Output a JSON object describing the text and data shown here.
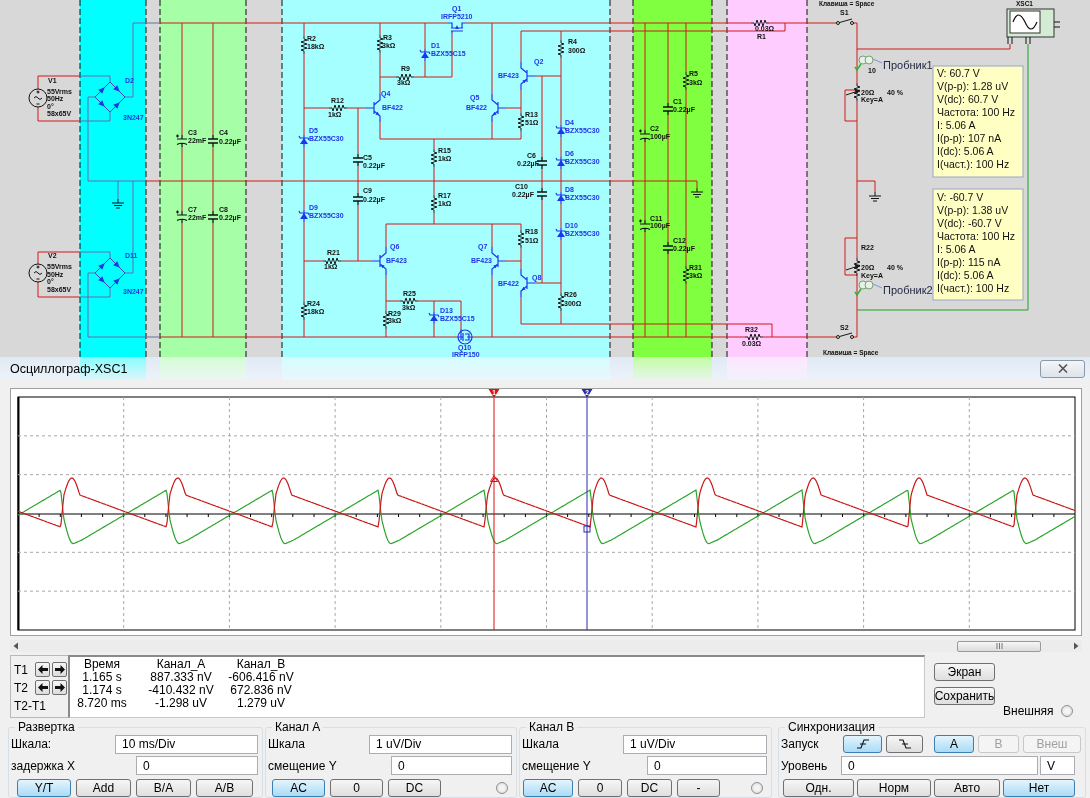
{
  "schematic": {
    "zones": [
      {
        "color": "#00ffff"
      },
      {
        "color": "#a6ffa6"
      },
      {
        "color": "#a6ffff"
      },
      {
        "color": "#80ff40"
      },
      {
        "color": "#ffccff"
      }
    ],
    "components": [
      {
        "kind": "ac-source",
        "ref": "V1",
        "values": [
          "55Vrms",
          "50Hz",
          "0°",
          "58x65V"
        ]
      },
      {
        "kind": "bridge",
        "ref": "D2",
        "values": [
          "3N247"
        ]
      },
      {
        "kind": "ac-source",
        "ref": "V2",
        "values": [
          "55Vrms",
          "50Hz",
          "0°",
          "58x65V"
        ]
      },
      {
        "kind": "bridge",
        "ref": "D11",
        "values": [
          "3N247"
        ]
      },
      {
        "kind": "polar-capacitor",
        "ref": "C3",
        "values": [
          "22mF"
        ]
      },
      {
        "kind": "capacitor",
        "ref": "C4",
        "values": [
          "0.22µF"
        ]
      },
      {
        "kind": "polar-capacitor",
        "ref": "C7",
        "values": [
          "22mF"
        ]
      },
      {
        "kind": "capacitor",
        "ref": "C8",
        "values": [
          "0.22µF"
        ]
      },
      {
        "kind": "resistor",
        "ref": "R2",
        "values": [
          "18kΩ"
        ]
      },
      {
        "kind": "resistor",
        "ref": "R12",
        "values": [
          "1kΩ"
        ]
      },
      {
        "kind": "zener",
        "ref": "D5",
        "values": [
          "BZX55C30"
        ]
      },
      {
        "kind": "zener",
        "ref": "D9",
        "values": [
          "BZX55C30"
        ]
      },
      {
        "kind": "resistor",
        "ref": "R21",
        "values": [
          "1kΩ"
        ]
      },
      {
        "kind": "resistor",
        "ref": "R24",
        "values": [
          "18kΩ"
        ]
      },
      {
        "kind": "mosfet",
        "ref": "Q1",
        "values": [
          "IRFP5210"
        ]
      },
      {
        "kind": "resistor",
        "ref": "R3",
        "values": [
          "3kΩ"
        ]
      },
      {
        "kind": "zener",
        "ref": "D1",
        "values": [
          "BZX55C15"
        ]
      },
      {
        "kind": "resistor",
        "ref": "R9",
        "values": [
          "3kΩ"
        ]
      },
      {
        "kind": "npn",
        "ref": "Q4",
        "values": [
          "BF422"
        ]
      },
      {
        "kind": "npn",
        "ref": "Q5",
        "values": [
          "BF422"
        ]
      },
      {
        "kind": "capacitor",
        "ref": "C5",
        "values": [
          "0.22µF"
        ]
      },
      {
        "kind": "resistor",
        "ref": "R15",
        "values": [
          "1kΩ"
        ]
      },
      {
        "kind": "capacitor",
        "ref": "C9",
        "values": [
          "0.22µF"
        ]
      },
      {
        "kind": "resistor",
        "ref": "R17",
        "values": [
          "1kΩ"
        ]
      },
      {
        "kind": "pnp",
        "ref": "Q6",
        "values": [
          "BF423"
        ]
      },
      {
        "kind": "resistor",
        "ref": "R25",
        "values": [
          "3kΩ"
        ]
      },
      {
        "kind": "resistor",
        "ref": "R29",
        "values": [
          "3kΩ"
        ]
      },
      {
        "kind": "zener",
        "ref": "D13",
        "values": [
          "BZX55C15"
        ]
      },
      {
        "kind": "mosfet",
        "ref": "Q10",
        "values": [
          "IRFP150"
        ]
      },
      {
        "kind": "pnp",
        "ref": "Q2",
        "values": [
          "BF423"
        ]
      },
      {
        "kind": "resistor",
        "ref": "R4",
        "values": [
          "300Ω"
        ]
      },
      {
        "kind": "resistor",
        "ref": "R13",
        "values": [
          "51Ω"
        ]
      },
      {
        "kind": "zener",
        "ref": "D4",
        "values": [
          "BZX55C30"
        ]
      },
      {
        "kind": "capacitor",
        "ref": "C6",
        "values": [
          "0.22µF"
        ]
      },
      {
        "kind": "zener",
        "ref": "D6",
        "values": [
          "BZX55C30"
        ]
      },
      {
        "kind": "capacitor",
        "ref": "C10",
        "values": [
          "0.22µF"
        ]
      },
      {
        "kind": "zener",
        "ref": "D8",
        "values": [
          "BZX55C30"
        ]
      },
      {
        "kind": "zener",
        "ref": "D10",
        "values": [
          "BZX55C30"
        ]
      },
      {
        "kind": "resistor",
        "ref": "R18",
        "values": [
          "51Ω"
        ]
      },
      {
        "kind": "pnp",
        "ref": "Q7",
        "values": [
          "BF423"
        ]
      },
      {
        "kind": "npn",
        "ref": "Q8",
        "values": [
          "BF422"
        ]
      },
      {
        "kind": "resistor",
        "ref": "R26",
        "values": [
          "300Ω"
        ]
      },
      {
        "kind": "resistor",
        "ref": "R5",
        "values": [
          "3kΩ"
        ]
      },
      {
        "kind": "capacitor",
        "ref": "C1",
        "values": [
          "0.22µF"
        ]
      },
      {
        "kind": "polar-capacitor",
        "ref": "C2",
        "values": [
          "100µF"
        ]
      },
      {
        "kind": "polar-capacitor",
        "ref": "C11",
        "values": [
          "100µF"
        ]
      },
      {
        "kind": "capacitor",
        "ref": "C12",
        "values": [
          "0.22µF"
        ]
      },
      {
        "kind": "resistor",
        "ref": "R31",
        "values": [
          "3kΩ"
        ]
      },
      {
        "kind": "resistor",
        "ref": "R1",
        "values": [
          "0.03Ω"
        ]
      },
      {
        "kind": "resistor",
        "ref": "R32",
        "values": [
          "0.03Ω"
        ]
      },
      {
        "kind": "switch",
        "ref": "S1",
        "values": [
          "Клавиша = Space"
        ]
      },
      {
        "kind": "switch",
        "ref": "S2",
        "values": [
          "Клавиша = Space"
        ]
      },
      {
        "kind": "potentiometer",
        "ref": "10",
        "values": [
          "20Ω",
          "Key=A",
          "40 %"
        ]
      },
      {
        "kind": "potentiometer",
        "ref": "R22",
        "values": [
          "20Ω",
          "Key=A",
          "40 %"
        ]
      }
    ],
    "probes": [
      {
        "label": "Пробник1",
        "readings": [
          "V: 60.7 V",
          "V(p-p): 1.28 uV",
          "V(dc): 60.7 V",
          "Частота: 100 Hz",
          "I: 5.06 A",
          "I(p-p): 107 nA",
          "I(dc): 5.06 A",
          "I(част.): 100 Hz"
        ]
      },
      {
        "label": "Пробник2",
        "readings": [
          "V: -60.7 V",
          "V(p-p): 1.38 uV",
          "V(dc): -60.7 V",
          "Частота: 100 Hz",
          "I: 5.06 A",
          "I(p-p): 115 nA",
          "I(dc): 5.06 A",
          "I(част.): 100 Hz"
        ]
      }
    ],
    "instrument": {
      "ref": "XSC1"
    }
  },
  "oscilloscope": {
    "title": "Осциллограф-XSC1",
    "cursors": [
      {
        "label": "1",
        "color": "#e01010"
      },
      {
        "label": "2",
        "color": "#2a2ab0"
      }
    ],
    "readout": {
      "cursor_labels": [
        "T1",
        "T2",
        "T2-T1"
      ],
      "columns": [
        "Время",
        "Канал_A",
        "Канал_B"
      ],
      "rows": [
        [
          "1.165 s",
          "887.333 nV",
          "-606.416 nV"
        ],
        [
          "1.174 s",
          "-410.432 nV",
          "672.836 nV"
        ],
        [
          "8.720 ms",
          "-1.298 uV",
          "1.279 uV"
        ]
      ]
    },
    "actions": [
      "Экран",
      "Сохранить"
    ],
    "external": {
      "label": "Внешняя",
      "checked": false
    },
    "timebase": {
      "title": "Развертка",
      "fields": [
        {
          "label": "Шкала:",
          "value": "10 ms/Div"
        },
        {
          "label": "задержка X",
          "value": "0"
        }
      ],
      "modes": [
        {
          "label": "Y/T",
          "selected": true
        },
        {
          "label": "Add",
          "selected": false
        },
        {
          "label": "B/A",
          "selected": false
        },
        {
          "label": "A/B",
          "selected": false
        }
      ]
    },
    "channels": [
      {
        "title": "Канал A",
        "fields": [
          {
            "label": "Шкала",
            "value": "1 uV/Div"
          },
          {
            "label": "смещение Y",
            "value": "0"
          }
        ],
        "coupling": [
          {
            "label": "AC",
            "selected": true
          },
          {
            "label": "0",
            "selected": false
          },
          {
            "label": "DC",
            "selected": false
          }
        ],
        "radio": {
          "checked": false
        }
      },
      {
        "title": "Канал B",
        "fields": [
          {
            "label": "Шкала",
            "value": "1 uV/Div"
          },
          {
            "label": "смещение Y",
            "value": "0"
          }
        ],
        "coupling": [
          {
            "label": "AC",
            "selected": true
          },
          {
            "label": "0",
            "selected": false
          },
          {
            "label": "DC",
            "selected": false
          },
          {
            "label": "-",
            "selected": false
          }
        ],
        "radio": {
          "checked": false
        }
      }
    ],
    "trigger": {
      "title": "Синхронизация",
      "edge_label": "Запуск",
      "edges": [
        {
          "kind": "rising",
          "selected": true
        },
        {
          "kind": "falling",
          "selected": false
        }
      ],
      "sources": [
        {
          "label": "A",
          "selected": true,
          "disabled": false
        },
        {
          "label": "B",
          "selected": false,
          "disabled": true
        },
        {
          "label": "Внеш",
          "selected": false,
          "disabled": true
        }
      ],
      "level_label": "Уровень",
      "level_value": "0",
      "level_unit": "V",
      "modes": [
        {
          "label": "Одн.",
          "selected": false
        },
        {
          "label": "Норм",
          "selected": false
        },
        {
          "label": "Авто",
          "selected": false
        },
        {
          "label": "Нет",
          "selected": true
        }
      ]
    }
  }
}
